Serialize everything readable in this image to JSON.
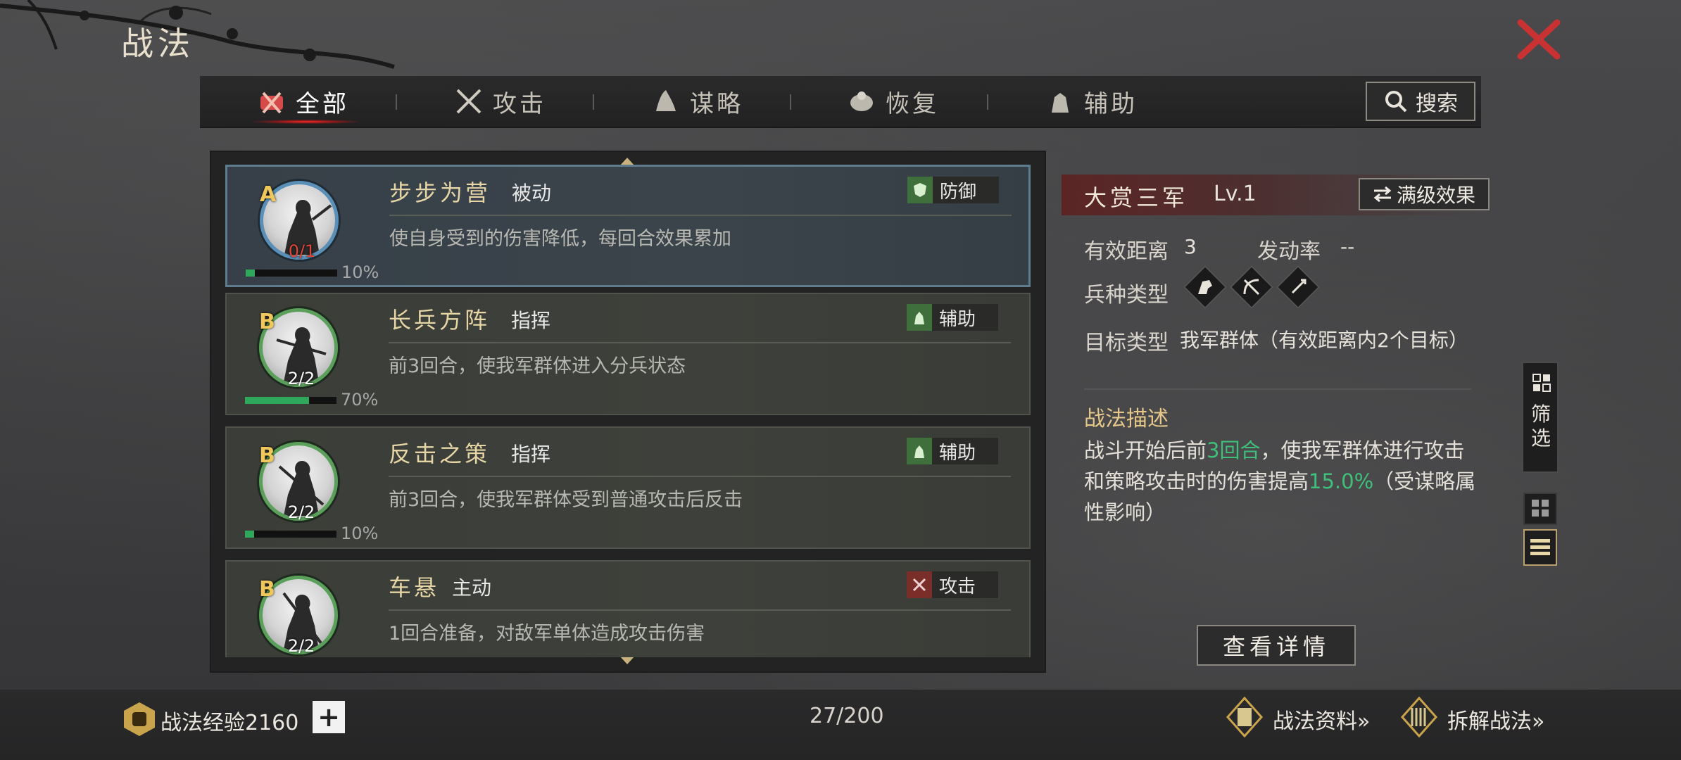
{
  "header": {
    "title": "战法",
    "close_icon": "close-x-icon"
  },
  "tabs": [
    {
      "label": "全部",
      "icon": "all-icon",
      "active": true
    },
    {
      "label": "攻击",
      "icon": "crossed-swords-icon",
      "active": false
    },
    {
      "label": "谋略",
      "icon": "scheme-icon",
      "active": false
    },
    {
      "label": "恢复",
      "icon": "recover-icon",
      "active": false
    },
    {
      "label": "辅助",
      "icon": "support-icon",
      "active": false
    }
  ],
  "search": {
    "label": "搜索",
    "icon": "search-icon"
  },
  "skills": [
    {
      "grade": "A",
      "name": "步步为营",
      "type": "被动",
      "desc": "使自身受到的伤害降低，每回合效果累加",
      "tag": "防御",
      "tag_icon": "shield-icon",
      "count": "0/1",
      "progress": 0.1,
      "progress_label": "10%",
      "selected": true
    },
    {
      "grade": "B",
      "name": "长兵方阵",
      "type": "指挥",
      "desc": "前3回合，使我军群体进入分兵状态",
      "tag": "辅助",
      "tag_icon": "support-icon",
      "count": "2/2",
      "progress": 0.7,
      "progress_label": "70%",
      "selected": false
    },
    {
      "grade": "B",
      "name": "反击之策",
      "type": "指挥",
      "desc": "前3回合，使我军群体受到普通攻击后反击",
      "tag": "辅助",
      "tag_icon": "support-icon",
      "count": "2/2",
      "progress": 0.1,
      "progress_label": "10%",
      "selected": false
    },
    {
      "grade": "B",
      "name": "车悬",
      "type": "主动",
      "desc": "1回合准备，对敌军单体造成攻击伤害",
      "tag": "攻击",
      "tag_icon": "crossed-swords-icon",
      "count": "2/2",
      "progress": 0.0,
      "progress_label": "",
      "selected": false
    }
  ],
  "detail": {
    "title": "大赏三军",
    "level": "Lv.1",
    "full_effect_label": "满级效果",
    "range_label": "有效距离",
    "range_value": "3",
    "rate_label": "发动率",
    "rate_value": "--",
    "unit_label": "兵种类型",
    "unit_icons": [
      "cavalry-icon",
      "archer-icon",
      "spear-icon"
    ],
    "target_label": "目标类型",
    "target_value": "我军群体（有效距离内2个目标）",
    "desc_title": "战法描述",
    "desc_part1": "战斗开始后前",
    "desc_hl1": "3回合",
    "desc_part2": "，使我军群体进行攻击和策略攻击时的伤害提高",
    "desc_hl2": "15.0%",
    "desc_part3": "（受谋略属性影响）",
    "view_detail_label": "查看详情"
  },
  "side": {
    "filter_label": "筛选"
  },
  "footer": {
    "exp_label": "战法经验2160",
    "add_label": "+",
    "count": "27/200",
    "info_label": "战法资料»",
    "decompose_label": "拆解战法»"
  },
  "colors": {
    "accent_red": "#d43a3a",
    "highlight_green": "#3fc07a",
    "gold": "#e6c98a"
  }
}
